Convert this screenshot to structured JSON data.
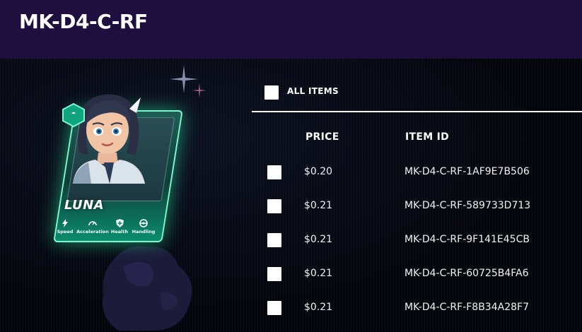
{
  "header": {
    "title": "MK-D4-C-RF"
  },
  "card": {
    "name": "LUNA",
    "badge": "-",
    "stats": [
      {
        "label": "Speed",
        "icon": "lightning-icon"
      },
      {
        "label": "Acceleration",
        "icon": "speedometer-icon"
      },
      {
        "label": "Health",
        "icon": "shield-icon"
      },
      {
        "label": "Handling",
        "icon": "steering-wheel-icon"
      }
    ]
  },
  "list": {
    "select_all_label": "ALL ITEMS",
    "columns": {
      "price": "PRICE",
      "item_id": "ITEM ID"
    },
    "rows": [
      {
        "price": "$0.20",
        "item_id": "MK-D4-C-RF-1AF9E7B506"
      },
      {
        "price": "$0.21",
        "item_id": "MK-D4-C-RF-589733D713"
      },
      {
        "price": "$0.21",
        "item_id": "MK-D4-C-RF-9F141E45CB"
      },
      {
        "price": "$0.21",
        "item_id": "MK-D4-C-RF-60725B4FA6"
      },
      {
        "price": "$0.21",
        "item_id": "MK-D4-C-RF-F8B34A28F7"
      }
    ]
  },
  "colors": {
    "header_bg": "#1f0f3e",
    "page_bg": "#05060c",
    "card_glow": "#2affaa",
    "text": "#ffffff"
  }
}
